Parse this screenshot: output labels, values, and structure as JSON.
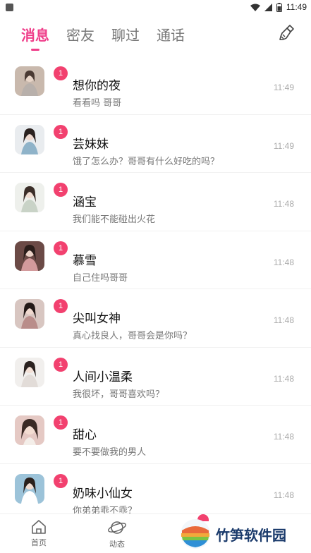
{
  "status_bar": {
    "time": "11:49"
  },
  "tabs": [
    {
      "label": "消息",
      "active": true
    },
    {
      "label": "密友",
      "active": false
    },
    {
      "label": "聊过",
      "active": false
    },
    {
      "label": "通话",
      "active": false
    }
  ],
  "messages": [
    {
      "name": "想你的夜",
      "preview": "看看吗 哥哥",
      "time": "11:49",
      "badge": "1",
      "avatar_color": "#c9b9ad"
    },
    {
      "name": "芸妹妹",
      "preview": "饿了怎么办？哥哥有什么好吃的吗？",
      "time": "11:49",
      "badge": "1",
      "avatar_color": "#8fb3c9"
    },
    {
      "name": "涵宝",
      "preview": "我们能不能碰出火花",
      "time": "11:48",
      "badge": "1",
      "avatar_color": "#d7ddd4"
    },
    {
      "name": "慕雪",
      "preview": "自己住吗哥哥",
      "time": "11:48",
      "badge": "1",
      "avatar_color": "#c98d8f"
    },
    {
      "name": "尖叫女神",
      "preview": "真心找良人，哥哥会是你吗？",
      "time": "11:48",
      "badge": "1",
      "avatar_color": "#b98d8a"
    },
    {
      "name": "人间小温柔",
      "preview": "我很坏，哥哥喜欢吗？",
      "time": "11:48",
      "badge": "1",
      "avatar_color": "#e2dcd8"
    },
    {
      "name": "甜心",
      "preview": "要不要做我的男人",
      "time": "11:48",
      "badge": "1",
      "avatar_color": "#e5c9c4"
    },
    {
      "name": "奶味小仙女",
      "preview": "你弟弟乖不乖？",
      "time": "11:48",
      "badge": "1",
      "avatar_color": "#9cc3d9"
    }
  ],
  "bottom_nav": [
    {
      "label": "首页",
      "icon": "home-icon"
    },
    {
      "label": "动态",
      "icon": "planet-icon"
    }
  ],
  "watermark": {
    "text": "竹笋软件园"
  },
  "colors": {
    "accent": "#ef3e8a",
    "badge": "#f2416f"
  }
}
